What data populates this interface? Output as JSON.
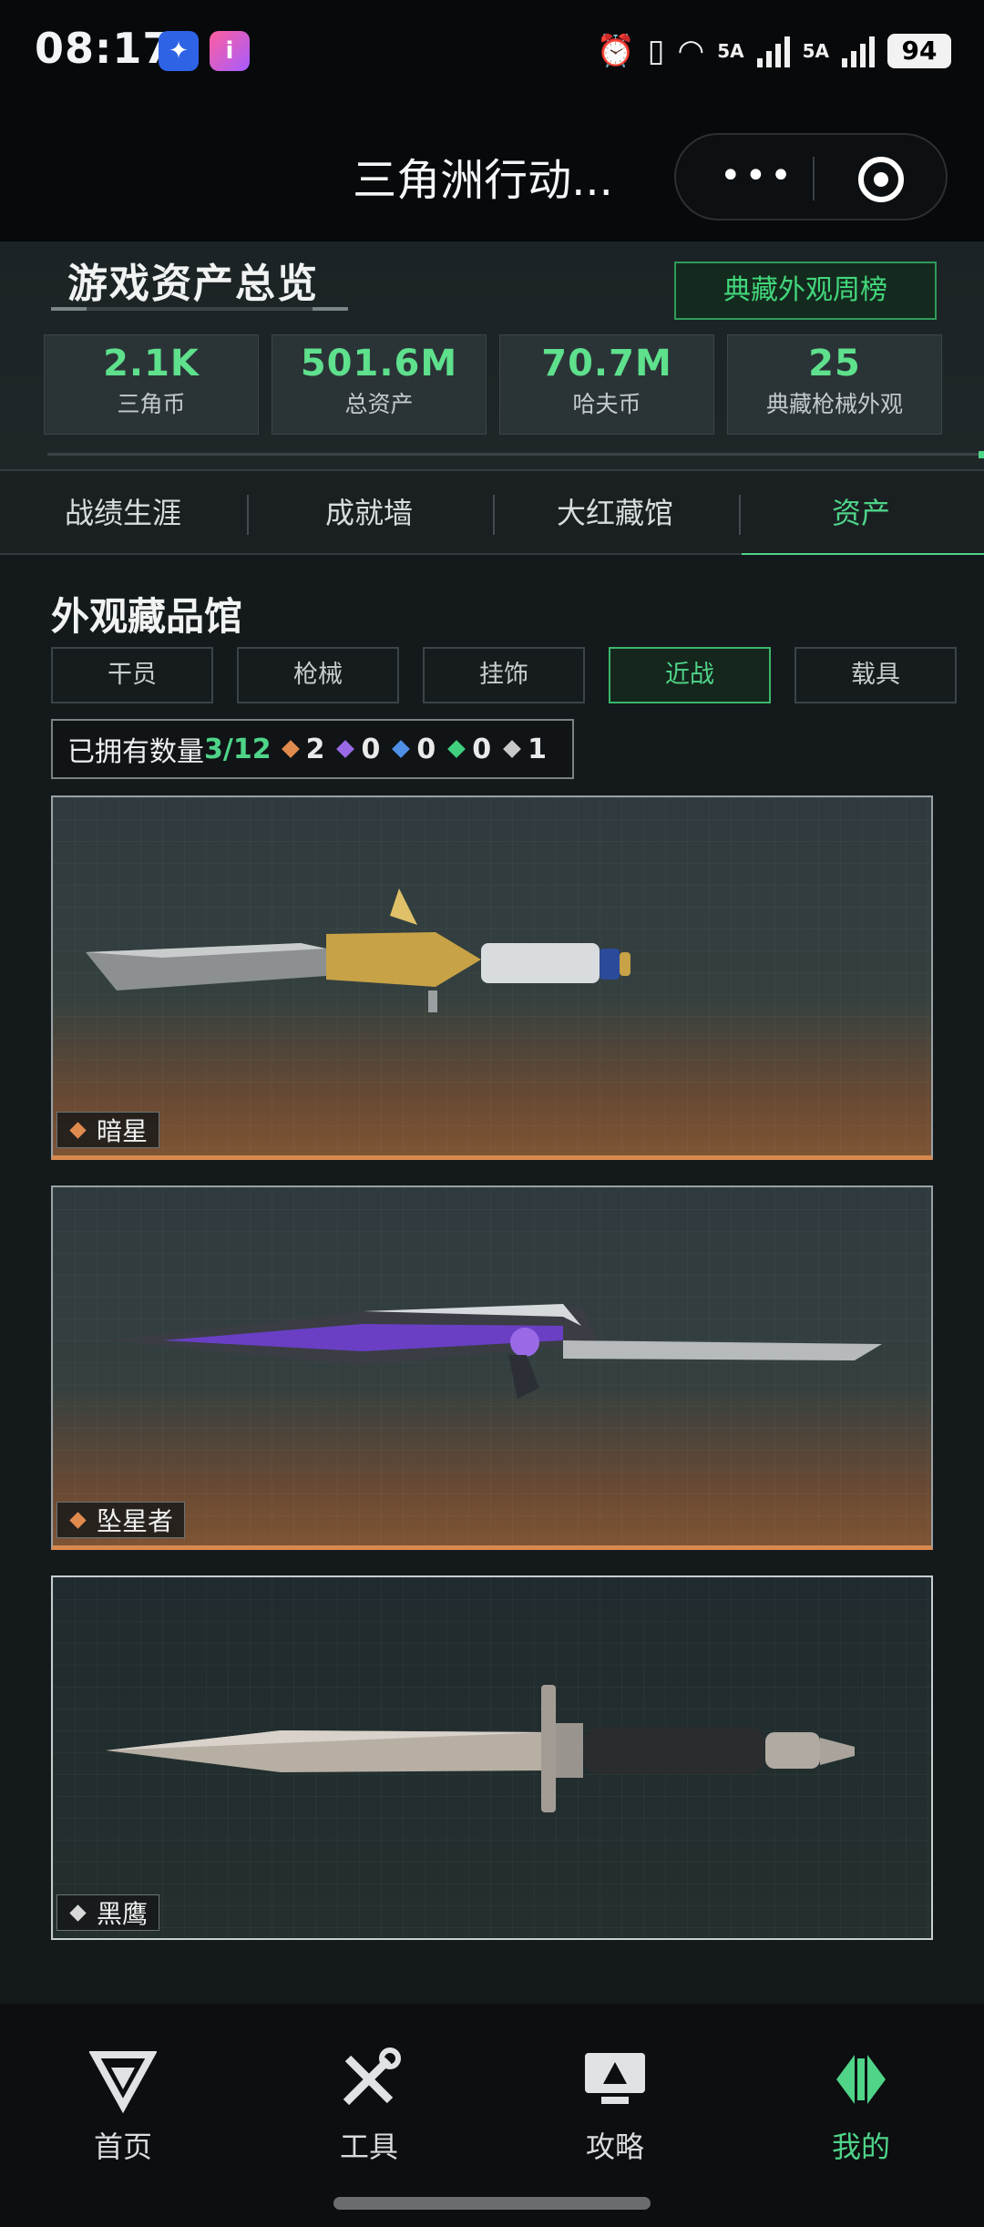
{
  "status_bar": {
    "time": "08:17",
    "battery": "94",
    "net1": "5A",
    "net2": "5A"
  },
  "header": {
    "title": "三角洲行动..."
  },
  "overview": {
    "title": "游戏资产总览",
    "weekly_button": "典藏外观周榜",
    "stats": [
      {
        "value": "2.1K",
        "label": "三角币"
      },
      {
        "value": "501.6M",
        "label": "总资产"
      },
      {
        "value": "70.7M",
        "label": "哈夫币"
      },
      {
        "value": "25",
        "label": "典藏枪械外观"
      }
    ]
  },
  "tabs": [
    {
      "label": "战绩生涯"
    },
    {
      "label": "成就墙"
    },
    {
      "label": "大红藏馆"
    },
    {
      "label": "资产",
      "active": true
    }
  ],
  "gallery": {
    "title": "外观藏品馆",
    "categories": [
      {
        "label": "干员"
      },
      {
        "label": "枪械"
      },
      {
        "label": "挂饰"
      },
      {
        "label": "近战",
        "active": true
      },
      {
        "label": "载具"
      }
    ],
    "owned_label": "已拥有数量",
    "owned_count": "3/12",
    "rarity_counts": [
      {
        "color": "#e08a4e",
        "count": "2"
      },
      {
        "color": "#9a6ae6",
        "count": "0"
      },
      {
        "color": "#4f8fe6",
        "count": "0"
      },
      {
        "color": "#3fcf7e",
        "count": "0"
      },
      {
        "color": "#c8c8c8",
        "count": "1"
      }
    ],
    "items": [
      {
        "name": "暗星",
        "rarity_color": "#e08a4e"
      },
      {
        "name": "坠星者",
        "rarity_color": "#e08a4e"
      },
      {
        "name": "黑鹰",
        "rarity_color": "#d8d8d8"
      }
    ]
  },
  "bottom_nav": [
    {
      "label": "首页",
      "icon": "home-logo-icon"
    },
    {
      "label": "工具",
      "icon": "tools-icon"
    },
    {
      "label": "攻略",
      "icon": "guide-monitor-icon"
    },
    {
      "label": "我的",
      "icon": "profile-logo-icon",
      "active": true
    }
  ],
  "colors": {
    "accent": "#4fd488",
    "background": "#141a1c"
  }
}
